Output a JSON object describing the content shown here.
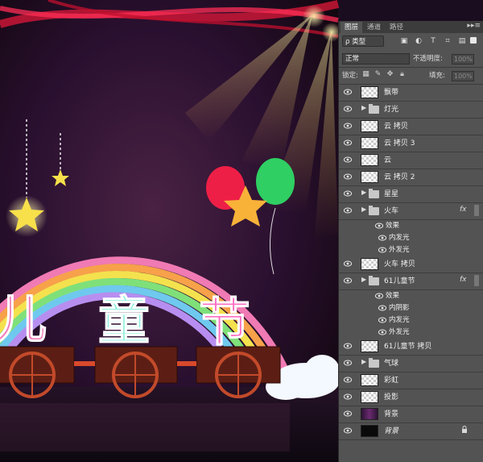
{
  "panel": {
    "tabs": [
      "图层",
      "通道",
      "路径"
    ],
    "menu_icon": "double-arrow-menu-icon",
    "filter": {
      "kind": "ρ 类型",
      "icons": [
        "image-filter-icon",
        "adjustment-filter-icon",
        "type-filter-icon",
        "shape-filter-icon",
        "smart-object-filter-icon"
      ]
    },
    "blend_mode": "正常",
    "opacity_label": "不透明度:",
    "opacity_value": "100%",
    "lock_label": "锁定:",
    "fill_label": "填充:",
    "fill_value": "100%"
  },
  "layers": [
    {
      "kind": "layer",
      "name": "飘带",
      "thumb": "checker"
    },
    {
      "kind": "group",
      "name": "灯光"
    },
    {
      "kind": "layer",
      "name": "云 拷贝",
      "thumb": "checker"
    },
    {
      "kind": "layer",
      "name": "云 拷贝 3",
      "thumb": "checker"
    },
    {
      "kind": "layer",
      "name": "云",
      "thumb": "checker"
    },
    {
      "kind": "layer",
      "name": "云 拷贝 2",
      "thumb": "checker"
    },
    {
      "kind": "group",
      "name": "星星"
    },
    {
      "kind": "group",
      "name": "火车",
      "fx": "fx"
    },
    {
      "kind": "effects",
      "name": "效果"
    },
    {
      "kind": "effect",
      "name": "内发光"
    },
    {
      "kind": "effect",
      "name": "外发光"
    },
    {
      "kind": "layer",
      "name": "火车 拷贝",
      "thumb": "checker"
    },
    {
      "kind": "group",
      "name": "61儿童节",
      "fx": "fx"
    },
    {
      "kind": "effects",
      "name": "效果"
    },
    {
      "kind": "effect",
      "name": "内阴影"
    },
    {
      "kind": "effect",
      "name": "内发光"
    },
    {
      "kind": "effect",
      "name": "外发光"
    },
    {
      "kind": "layer",
      "name": "61儿童节 拷贝",
      "thumb": "checker"
    },
    {
      "kind": "group",
      "name": "气球"
    },
    {
      "kind": "layer",
      "name": "彩虹",
      "thumb": "checker"
    },
    {
      "kind": "layer",
      "name": "投影",
      "thumb": "checker"
    },
    {
      "kind": "layer",
      "name": "背景",
      "thumb": "purple"
    },
    {
      "kind": "layer",
      "name": "背景",
      "thumb": "dark",
      "italic": true,
      "locked": true
    }
  ],
  "artwork": {
    "title_chars": [
      "儿",
      "童",
      "节"
    ],
    "colors": {
      "rainbow": [
        "#f06aa8",
        "#f7a14a",
        "#f4e14e",
        "#7fe07a",
        "#6fc9ee",
        "#b78ef0"
      ],
      "train": "#5c1e14",
      "wheel": "#c24a2a"
    }
  }
}
